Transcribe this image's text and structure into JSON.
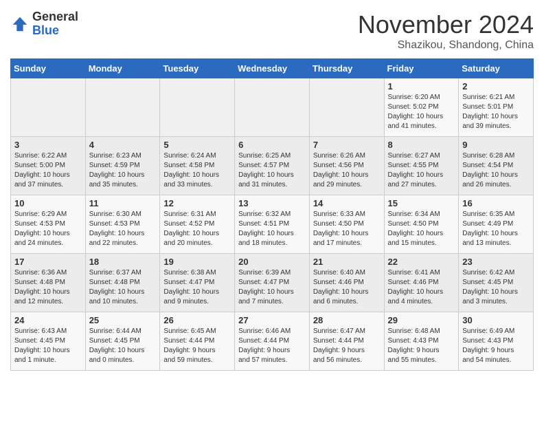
{
  "logo": {
    "general": "General",
    "blue": "Blue"
  },
  "header": {
    "title": "November 2024",
    "subtitle": "Shazikou, Shandong, China"
  },
  "days_of_week": [
    "Sunday",
    "Monday",
    "Tuesday",
    "Wednesday",
    "Thursday",
    "Friday",
    "Saturday"
  ],
  "weeks": [
    [
      {
        "day": "",
        "info": ""
      },
      {
        "day": "",
        "info": ""
      },
      {
        "day": "",
        "info": ""
      },
      {
        "day": "",
        "info": ""
      },
      {
        "day": "",
        "info": ""
      },
      {
        "day": "1",
        "info": "Sunrise: 6:20 AM\nSunset: 5:02 PM\nDaylight: 10 hours\nand 41 minutes."
      },
      {
        "day": "2",
        "info": "Sunrise: 6:21 AM\nSunset: 5:01 PM\nDaylight: 10 hours\nand 39 minutes."
      }
    ],
    [
      {
        "day": "3",
        "info": "Sunrise: 6:22 AM\nSunset: 5:00 PM\nDaylight: 10 hours\nand 37 minutes."
      },
      {
        "day": "4",
        "info": "Sunrise: 6:23 AM\nSunset: 4:59 PM\nDaylight: 10 hours\nand 35 minutes."
      },
      {
        "day": "5",
        "info": "Sunrise: 6:24 AM\nSunset: 4:58 PM\nDaylight: 10 hours\nand 33 minutes."
      },
      {
        "day": "6",
        "info": "Sunrise: 6:25 AM\nSunset: 4:57 PM\nDaylight: 10 hours\nand 31 minutes."
      },
      {
        "day": "7",
        "info": "Sunrise: 6:26 AM\nSunset: 4:56 PM\nDaylight: 10 hours\nand 29 minutes."
      },
      {
        "day": "8",
        "info": "Sunrise: 6:27 AM\nSunset: 4:55 PM\nDaylight: 10 hours\nand 27 minutes."
      },
      {
        "day": "9",
        "info": "Sunrise: 6:28 AM\nSunset: 4:54 PM\nDaylight: 10 hours\nand 26 minutes."
      }
    ],
    [
      {
        "day": "10",
        "info": "Sunrise: 6:29 AM\nSunset: 4:53 PM\nDaylight: 10 hours\nand 24 minutes."
      },
      {
        "day": "11",
        "info": "Sunrise: 6:30 AM\nSunset: 4:53 PM\nDaylight: 10 hours\nand 22 minutes."
      },
      {
        "day": "12",
        "info": "Sunrise: 6:31 AM\nSunset: 4:52 PM\nDaylight: 10 hours\nand 20 minutes."
      },
      {
        "day": "13",
        "info": "Sunrise: 6:32 AM\nSunset: 4:51 PM\nDaylight: 10 hours\nand 18 minutes."
      },
      {
        "day": "14",
        "info": "Sunrise: 6:33 AM\nSunset: 4:50 PM\nDaylight: 10 hours\nand 17 minutes."
      },
      {
        "day": "15",
        "info": "Sunrise: 6:34 AM\nSunset: 4:50 PM\nDaylight: 10 hours\nand 15 minutes."
      },
      {
        "day": "16",
        "info": "Sunrise: 6:35 AM\nSunset: 4:49 PM\nDaylight: 10 hours\nand 13 minutes."
      }
    ],
    [
      {
        "day": "17",
        "info": "Sunrise: 6:36 AM\nSunset: 4:48 PM\nDaylight: 10 hours\nand 12 minutes."
      },
      {
        "day": "18",
        "info": "Sunrise: 6:37 AM\nSunset: 4:48 PM\nDaylight: 10 hours\nand 10 minutes."
      },
      {
        "day": "19",
        "info": "Sunrise: 6:38 AM\nSunset: 4:47 PM\nDaylight: 10 hours\nand 9 minutes."
      },
      {
        "day": "20",
        "info": "Sunrise: 6:39 AM\nSunset: 4:47 PM\nDaylight: 10 hours\nand 7 minutes."
      },
      {
        "day": "21",
        "info": "Sunrise: 6:40 AM\nSunset: 4:46 PM\nDaylight: 10 hours\nand 6 minutes."
      },
      {
        "day": "22",
        "info": "Sunrise: 6:41 AM\nSunset: 4:46 PM\nDaylight: 10 hours\nand 4 minutes."
      },
      {
        "day": "23",
        "info": "Sunrise: 6:42 AM\nSunset: 4:45 PM\nDaylight: 10 hours\nand 3 minutes."
      }
    ],
    [
      {
        "day": "24",
        "info": "Sunrise: 6:43 AM\nSunset: 4:45 PM\nDaylight: 10 hours\nand 1 minute."
      },
      {
        "day": "25",
        "info": "Sunrise: 6:44 AM\nSunset: 4:45 PM\nDaylight: 10 hours\nand 0 minutes."
      },
      {
        "day": "26",
        "info": "Sunrise: 6:45 AM\nSunset: 4:44 PM\nDaylight: 9 hours\nand 59 minutes."
      },
      {
        "day": "27",
        "info": "Sunrise: 6:46 AM\nSunset: 4:44 PM\nDaylight: 9 hours\nand 57 minutes."
      },
      {
        "day": "28",
        "info": "Sunrise: 6:47 AM\nSunset: 4:44 PM\nDaylight: 9 hours\nand 56 minutes."
      },
      {
        "day": "29",
        "info": "Sunrise: 6:48 AM\nSunset: 4:43 PM\nDaylight: 9 hours\nand 55 minutes."
      },
      {
        "day": "30",
        "info": "Sunrise: 6:49 AM\nSunset: 4:43 PM\nDaylight: 9 hours\nand 54 minutes."
      }
    ]
  ]
}
